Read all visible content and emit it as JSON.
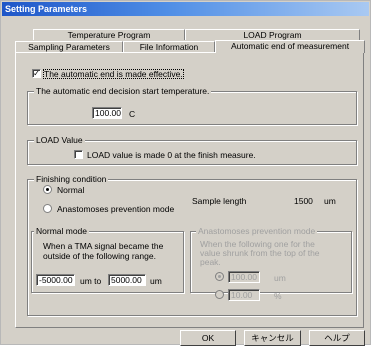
{
  "window": {
    "title": "Setting Parameters"
  },
  "tabs": {
    "row1": [
      "Temperature Program",
      "LOAD Program"
    ],
    "row2": [
      "Sampling Parameters",
      "File Information",
      "Automatic end of measurement"
    ]
  },
  "auto_end": {
    "checkbox_label": "The automatic end is made effective.",
    "checked": true
  },
  "start_temp": {
    "legend": "The automatic end decision start temperature.",
    "value": "100.00",
    "unit": "C"
  },
  "load_value": {
    "legend": "LOAD Value",
    "checkbox_label": "LOAD value is made 0 at the finish measure.",
    "checked": false
  },
  "finishing": {
    "legend": "Finishing condition",
    "options": [
      "Normal",
      "Anastomoses prevention mode"
    ],
    "selected": "Normal",
    "sample_length_label": "Sample length",
    "sample_length_value": "1500",
    "sample_length_unit": "um"
  },
  "normal_mode": {
    "legend": "Normal mode",
    "desc_line1": "When a TMA signal became the",
    "desc_line2": "outside of the following range.",
    "from_value": "-5000.00",
    "to_label": "um to",
    "to_value": "5000.00",
    "unit": "um"
  },
  "anastomoses_mode": {
    "legend": "Anastomoses prevention mode",
    "desc_line1": "When the following one for the",
    "desc_line2": "value shrunk from the top of the",
    "desc_line3": "peak.",
    "opt1_value": "100.00",
    "opt1_unit": "um",
    "opt2_value": "10.00",
    "opt2_unit": "%"
  },
  "buttons": {
    "ok": "OK",
    "cancel": "キャンセル",
    "help": "ヘルプ"
  }
}
